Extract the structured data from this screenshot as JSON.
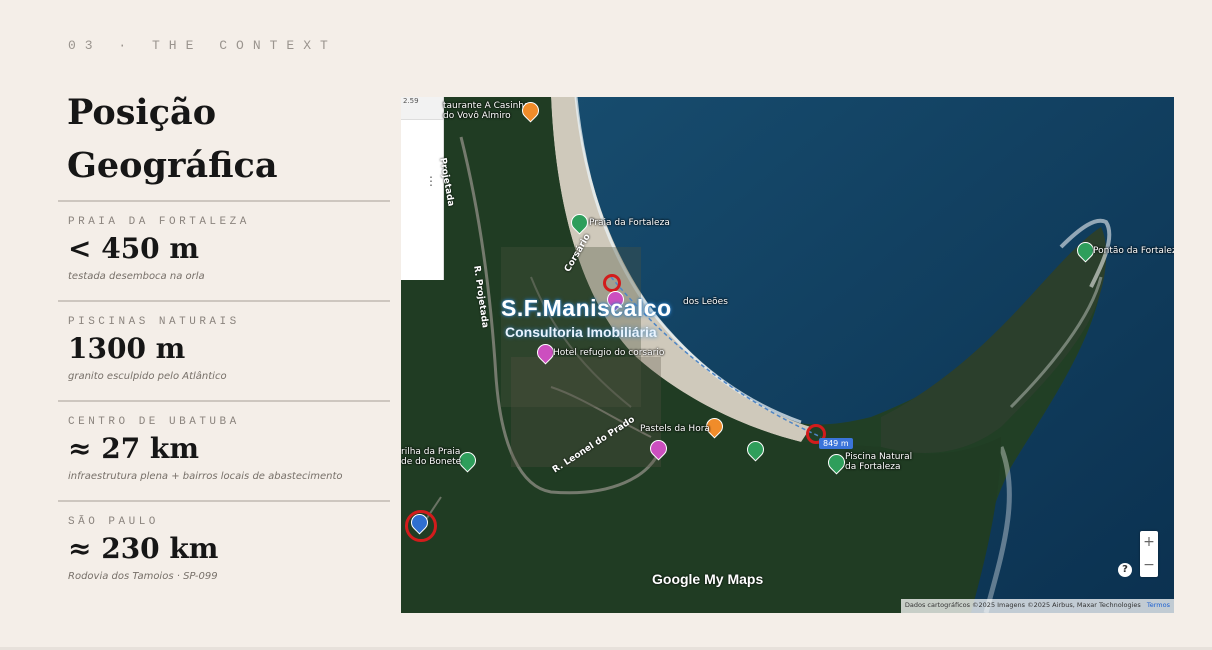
{
  "eyebrow": "03 · THE CONTEXT",
  "title_line1": "Posição",
  "title_line2": "Geográfica",
  "stats": [
    {
      "label": "PRAIA DA FORTALEZA",
      "value": "< 450 m",
      "caption": "testada desemboca na orla"
    },
    {
      "label": "PISCINAS NATURAIS",
      "value": "1300 m",
      "caption": "granito esculpido pelo Atlântico"
    },
    {
      "label": "CENTRO DE UBATUBA",
      "value": "≈ 27 km",
      "caption": "infraestrutura plena + bairros locais de abastecimento"
    },
    {
      "label": "SÃO PAULO",
      "value": "≈ 230 km",
      "caption": "Rodovia dos Tamoios · SP-099"
    }
  ],
  "map": {
    "labels": {
      "restaurant": "taurante A Casinha\ndo Vovô Almiro",
      "praia_fortaleza": "Praia da Fortaleza",
      "pontao": "Pontão da Fortaleza",
      "dos_leoes": "dos Leões",
      "hotel": "Hotel refugio do corsario",
      "pastels": "Pastels da Hora",
      "piscina_natural": "Piscina Natural\nda Fortaleza",
      "trilha": "rilha da Praia\nde do Bonete",
      "road_projetada_1": "Projetada",
      "road_projetada_2": "R. Projetada",
      "road_leonel": "R. Leonel do Prado",
      "road_corsario": "Corsário"
    },
    "watermark": "S.F.Maniscalco",
    "watermark_sub": "Consultoria Imobiliária",
    "distance_badge": "849 m",
    "side_panel_top": "2.59",
    "google_brand": "Google My Maps",
    "attribution": "Dados cartográficos ©2025 Imagens ©2025 Airbus, Maxar Technologies",
    "terms": "Termos",
    "zoom_in": "+",
    "zoom_out": "−",
    "help": "?"
  },
  "colors": {
    "background": "#f4eee8",
    "title": "#161616",
    "sea": "#0f3a5c",
    "forest": "#1f3d22",
    "sand": "#c9c3b6",
    "marker_circle": "#d21c1c"
  }
}
